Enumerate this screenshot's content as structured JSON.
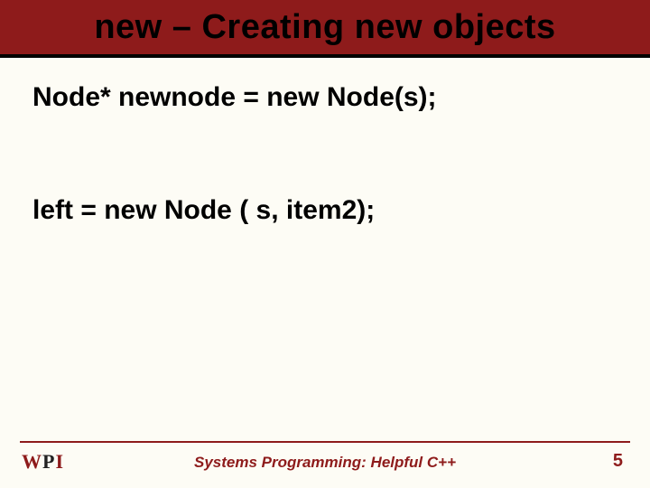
{
  "title": "new – Creating new objects",
  "lines": {
    "l1": "Node* newnode = new Node(s);",
    "l2": "left = new Node ( s, item2);"
  },
  "footer": {
    "logo_w": "W",
    "logo_p": "P",
    "logo_i": "I",
    "center": "Systems Programming: Helpful C++",
    "pagenum": "5"
  }
}
